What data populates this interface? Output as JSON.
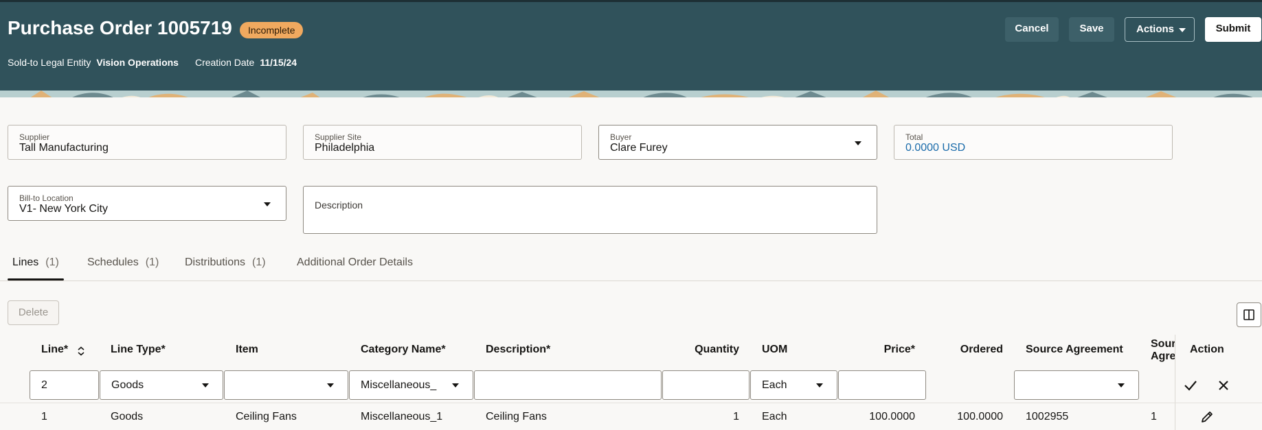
{
  "header": {
    "title": "Purchase Order 1005719",
    "status": "Incomplete",
    "sold_to_label": "Sold-to Legal Entity",
    "sold_to_value": "Vision Operations",
    "creation_date_label": "Creation Date",
    "creation_date_value": "11/15/24",
    "buttons": {
      "cancel": "Cancel",
      "save": "Save",
      "actions": "Actions",
      "submit": "Submit"
    }
  },
  "form": {
    "supplier": {
      "label": "Supplier",
      "value": "Tall Manufacturing"
    },
    "supplier_site": {
      "label": "Supplier Site",
      "value": "Philadelphia"
    },
    "buyer": {
      "label": "Buyer",
      "value": "Clare Furey"
    },
    "total": {
      "label": "Total",
      "value": "0.0000 USD"
    },
    "bill_to_location": {
      "label": "Bill-to Location",
      "value": "V1- New York City"
    },
    "description": {
      "label": "Description",
      "value": ""
    }
  },
  "tabs": [
    {
      "label": "Lines",
      "count": "(1)",
      "active": true
    },
    {
      "label": "Schedules",
      "count": "(1)",
      "active": false
    },
    {
      "label": "Distributions",
      "count": "(1)",
      "active": false
    },
    {
      "label": "Additional Order Details",
      "count": "",
      "active": false
    }
  ],
  "toolbar": {
    "delete_label": "Delete"
  },
  "table": {
    "columns": {
      "line": "Line*",
      "line_type": "Line Type*",
      "item": "Item",
      "category": "Category Name*",
      "description": "Description*",
      "quantity": "Quantity",
      "uom": "UOM",
      "price": "Price*",
      "ordered": "Ordered",
      "source_agreement": "Source Agreement",
      "source_agreement_line_1": "Sour",
      "source_agreement_line_2": "Agre",
      "action": "Action"
    },
    "edit_row": {
      "line": "2",
      "line_type": "Goods",
      "item": "",
      "category": "Miscellaneous_",
      "description": "",
      "quantity": "",
      "uom": "Each",
      "price": "",
      "source_agreement": ""
    },
    "rows": [
      {
        "line": "1",
        "line_type": "Goods",
        "item": "Ceiling Fans",
        "category": "Miscellaneous_1",
        "description": "Ceiling Fans",
        "quantity": "1",
        "uom": "Each",
        "price": "100.0000",
        "ordered": "100.0000",
        "source_agreement": "1002955",
        "source_agreement_line": "1"
      }
    ]
  },
  "icons": {
    "sort": "sort-icon",
    "dropdown": "chevron-down-icon",
    "columns": "columns-icon",
    "confirm": "check-icon",
    "cancel": "close-icon",
    "edit": "pencil-icon"
  },
  "colors": {
    "header_bg": "#30525b",
    "badge_bg": "#f0a95f",
    "link": "#1a6baa"
  }
}
